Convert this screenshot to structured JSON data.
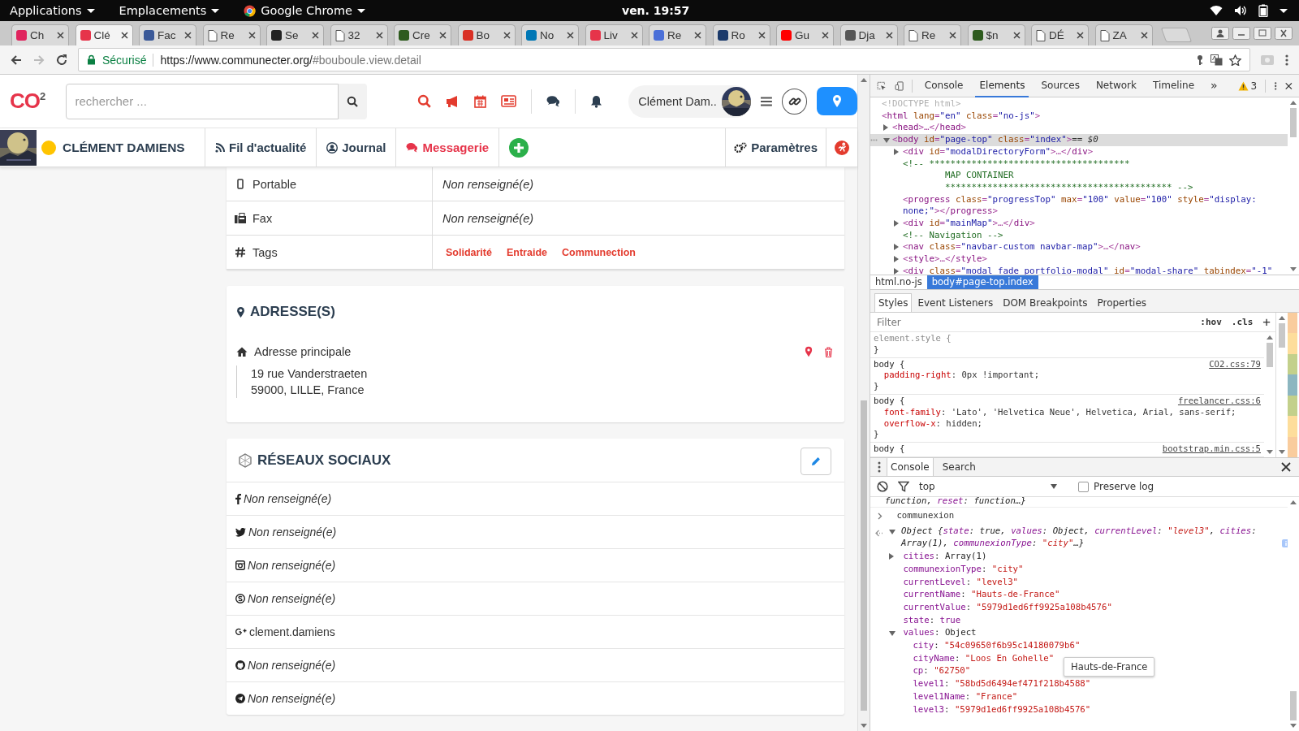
{
  "os_bar": {
    "menus": [
      "Applications",
      "Emplacements",
      "Google Chrome"
    ],
    "clock": "ven. 19:57"
  },
  "browser": {
    "tabs": [
      {
        "title": "Ch",
        "kind": "site",
        "color": "#e0245e",
        "selected": false
      },
      {
        "title": "Clé",
        "kind": "site",
        "color": "#e6344a",
        "selected": true
      },
      {
        "title": "Fac",
        "kind": "site",
        "color": "#3b5998",
        "selected": false
      },
      {
        "title": "Re",
        "kind": "page",
        "selected": false
      },
      {
        "title": "Se",
        "kind": "site",
        "color": "#222222",
        "selected": false
      },
      {
        "title": "32",
        "kind": "page",
        "selected": false
      },
      {
        "title": "Cre",
        "kind": "site",
        "color": "#2e5b1e",
        "selected": false
      },
      {
        "title": "Bo",
        "kind": "site",
        "color": "#d93025",
        "selected": false
      },
      {
        "title": "No",
        "kind": "site",
        "color": "#0077b5",
        "selected": false
      },
      {
        "title": "Liv",
        "kind": "site",
        "color": "#e6344a",
        "selected": false
      },
      {
        "title": "Re",
        "kind": "site",
        "color": "#4a6fd8",
        "selected": false
      },
      {
        "title": "Ro",
        "kind": "site",
        "color": "#1b3a6b",
        "selected": false
      },
      {
        "title": "Gu",
        "kind": "site",
        "color": "#ff0000",
        "selected": false
      },
      {
        "title": "Dja",
        "kind": "site",
        "color": "#555555",
        "selected": false
      },
      {
        "title": "Re",
        "kind": "page",
        "selected": false
      },
      {
        "title": "$n",
        "kind": "site",
        "color": "#2e5b1e",
        "selected": false
      },
      {
        "title": "DÉ",
        "kind": "page",
        "selected": false
      },
      {
        "title": "ZA",
        "kind": "page",
        "selected": false
      }
    ],
    "secure_label": "Sécurisé",
    "url": {
      "host": "https://www.communecter.org/",
      "path": "#bouboule.view.detail"
    }
  },
  "site": {
    "logo": "CO$^{2}$",
    "search": {
      "placeholder": "rechercher ..."
    },
    "user_name": "Clément Dam..",
    "profile_name": "CLÉMENT DAMIENS",
    "nav": [
      {
        "label": "Fil d'actualité",
        "kind": "rss",
        "selected": false
      },
      {
        "label": "Journal",
        "kind": "user",
        "selected": false
      },
      {
        "label": "Messagerie",
        "kind": "chat",
        "selected": true
      }
    ],
    "settings_label": "Paramètres",
    "info_rows": [
      {
        "kind": "mobile",
        "label": "Portable",
        "value": "Non renseigné(e)"
      },
      {
        "kind": "fax",
        "label": "Fax",
        "value": "Non renseigné(e)"
      },
      {
        "kind": "tags",
        "label": "Tags",
        "tags": [
          "Solidarité",
          "Entraide",
          "Communection"
        ]
      }
    ],
    "address": {
      "title": "ADRESSE(S)",
      "label": "Adresse principale",
      "lines": [
        "19 rue Vanderstraeten",
        "59000, LILLE, France"
      ]
    },
    "social": {
      "title": "RÉSEAUX SOCIAUX",
      "rows": [
        {
          "kind": "facebook",
          "value": "Non renseigné(e)",
          "empty": true
        },
        {
          "kind": "twitter",
          "value": "Non renseigné(e)",
          "empty": true
        },
        {
          "kind": "instagram",
          "value": "Non renseigné(e)",
          "empty": true
        },
        {
          "kind": "skype",
          "value": "Non renseigné(e)",
          "empty": true
        },
        {
          "kind": "googleplus",
          "value": "clement.damiens",
          "empty": false
        },
        {
          "kind": "github",
          "value": "Non renseigné(e)",
          "empty": true
        },
        {
          "kind": "telegram",
          "value": "Non renseigné(e)",
          "empty": true
        }
      ]
    }
  },
  "devtools": {
    "tabs": [
      {
        "label": "Console",
        "selected": false
      },
      {
        "label": "Elements",
        "selected": true
      },
      {
        "label": "Sources",
        "selected": false
      },
      {
        "label": "Network",
        "selected": false
      },
      {
        "label": "Timeline",
        "selected": false
      }
    ],
    "more": "»",
    "warnings": "3",
    "dom": [
      {
        "kind": "doctype",
        "text": "<!DOCTYPE html>",
        "selected": false
      },
      {
        "kind": "element",
        "text": "<html lang=\"en\" class=\"no-js\">",
        "selected": false,
        "children": [
          {
            "kind": "element",
            "text": "<head>…</head>",
            "selected": false,
            "expanded": false
          },
          {
            "kind": "element",
            "text": "<body id=\"page-top\" class=\"index\">",
            "marker": "== $0",
            "selected": true,
            "expanded": true,
            "children": [
              {
                "kind": "element",
                "text": "<div id=\"modalDirectoryForm\">…</div>",
                "selected": false,
                "expanded": false
              },
              {
                "kind": "comment",
                "lines": [
                  "<!-- **************************************",
                  "MAP CONTAINER",
                  "******************************************* -->"
                ],
                "selected": false
              },
              {
                "kind": "element",
                "text": "<progress class=\"progressTop\" max=\"100\" value=\"100\" style=\"display: none;\"></progress>",
                "selected": false
              },
              {
                "kind": "element",
                "text": "<div id=\"mainMap\">…</div>",
                "selected": false,
                "expanded": false
              },
              {
                "kind": "comment",
                "lines": [
                  "<!-- Navigation -->"
                ],
                "selected": false
              },
              {
                "kind": "element",
                "text": "<nav class=\"navbar-custom navbar-map\">…</nav>",
                "selected": false,
                "expanded": false
              },
              {
                "kind": "element",
                "text": "<style>…</style>",
                "selected": false,
                "expanded": false
              },
              {
                "kind": "element",
                "text": "<div class=\"modal fade portfolio-modal\" id=\"modal-share\" tabindex=\"-1\"",
                "selected": false,
                "expanded": false
              }
            ]
          }
        ]
      }
    ],
    "breadcrumbs": [
      {
        "label": "html.no-js",
        "selected": false
      },
      {
        "label": "body#page-top.index",
        "selected": true
      }
    ],
    "style_tabs": [
      {
        "label": "Styles",
        "selected": true
      },
      {
        "label": "Event Listeners",
        "selected": false
      },
      {
        "label": "DOM Breakpoints",
        "selected": false
      },
      {
        "label": "Properties",
        "selected": false
      }
    ],
    "filter": {
      "placeholder": "Filter"
    },
    "hov": ":hov",
    "cls": ".cls",
    "add": "+",
    "rules": [
      {
        "kind": "inline",
        "selector": "element.style {",
        "close": "}"
      },
      {
        "kind": "rule",
        "selector": "body {",
        "source": "CO2.css:79",
        "declarations": [
          "padding-right: 0px !important;"
        ],
        "close": "}"
      },
      {
        "kind": "rule",
        "selector": "body {",
        "source": "freelancer.css:6",
        "declarations": [
          "font-family: 'Lato', 'Helvetica Neue', Helvetica, Arial, sans-serif;",
          "overflow-x: hidden;"
        ],
        "close": "}"
      },
      {
        "kind": "rule",
        "selector": "body {",
        "source": "bootstrap.min.css:5"
      }
    ],
    "drawer": {
      "tabs": [
        {
          "label": "Console",
          "selected": true
        },
        {
          "label": "Search",
          "selected": false
        }
      ],
      "context": "top",
      "preserve_log": {
        "label": "Preserve log",
        "checked": false
      }
    },
    "console": [
      {
        "kind": "cut",
        "text": "function, reset: function…}"
      },
      {
        "kind": "input",
        "text": "communexion"
      },
      {
        "kind": "result",
        "summary": "Object {state: true, values: Object, currentLevel: \"level3\", cities: Array(1), communexionType: \"city\"…}",
        "expanded": true,
        "children": [
          {
            "text": "cities: Array(1)",
            "kind": "object",
            "expanded": false
          },
          {
            "text": "communexionType: \"city\"",
            "kind": "string"
          },
          {
            "text": "currentLevel: \"level3\"",
            "kind": "string"
          },
          {
            "text": "currentName: \"Hauts-de-France\"",
            "kind": "string"
          },
          {
            "text": "currentValue: \"5979d1ed6ff9925a108b4576\"",
            "kind": "string"
          },
          {
            "text": "state: true",
            "kind": "boolean"
          },
          {
            "text": "values: Object",
            "kind": "object",
            "expanded": true,
            "children": [
              {
                "text": "city: \"54c09650f6b95c14180079b6\"",
                "kind": "string"
              },
              {
                "text": "cityName: \"Loos En Gohelle\"",
                "kind": "string"
              },
              {
                "text": "cp: \"62750\"",
                "kind": "string"
              },
              {
                "text": "level1: \"58bd5d6494ef471f218b4588\"",
                "kind": "string"
              },
              {
                "text": "level1Name: \"France\"",
                "kind": "string"
              },
              {
                "text": "level3: \"5979d1ed6ff9925a108b4576\"",
                "kind": "string"
              }
            ]
          }
        ]
      }
    ],
    "tooltip": "Hauts-de-France"
  }
}
